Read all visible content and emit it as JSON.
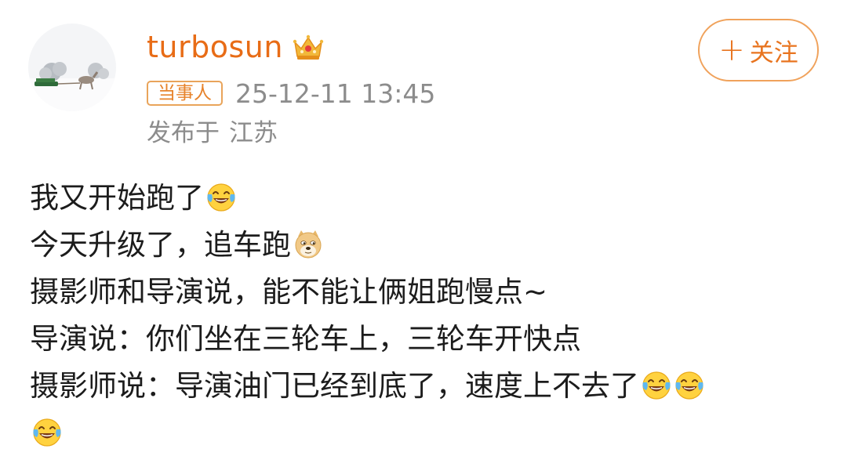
{
  "user": {
    "username": "turbosun",
    "role_badge": "当事人",
    "timestamp": "25-12-11 13:45",
    "location_prefix": "发布于",
    "location": "江苏",
    "follow_label": "关注",
    "follow_plus": "+"
  },
  "colors": {
    "brand_orange": "#e86c16",
    "meta_gray": "#8c8c8c",
    "text": "#1c1c1c"
  },
  "post": {
    "lines": [
      {
        "text": "我又开始跑了",
        "emojis": [
          "laugh-cry-emoji"
        ]
      },
      {
        "text": "今天升级了，追车跑",
        "emojis": [
          "doge-emoji"
        ]
      },
      {
        "text": "摄影师和导演说，能不能让俩姐跑慢点~",
        "emojis": []
      },
      {
        "text": "导演说：你们坐在三轮车上，三轮车开快点",
        "emojis": []
      },
      {
        "text": "摄影师说：导演油门已经到底了，速度上不去了",
        "emojis": [
          "laugh-cry-emoji",
          "laugh-cry-emoji"
        ]
      },
      {
        "text": "",
        "emojis": [
          "laugh-cry-emoji"
        ]
      }
    ]
  }
}
